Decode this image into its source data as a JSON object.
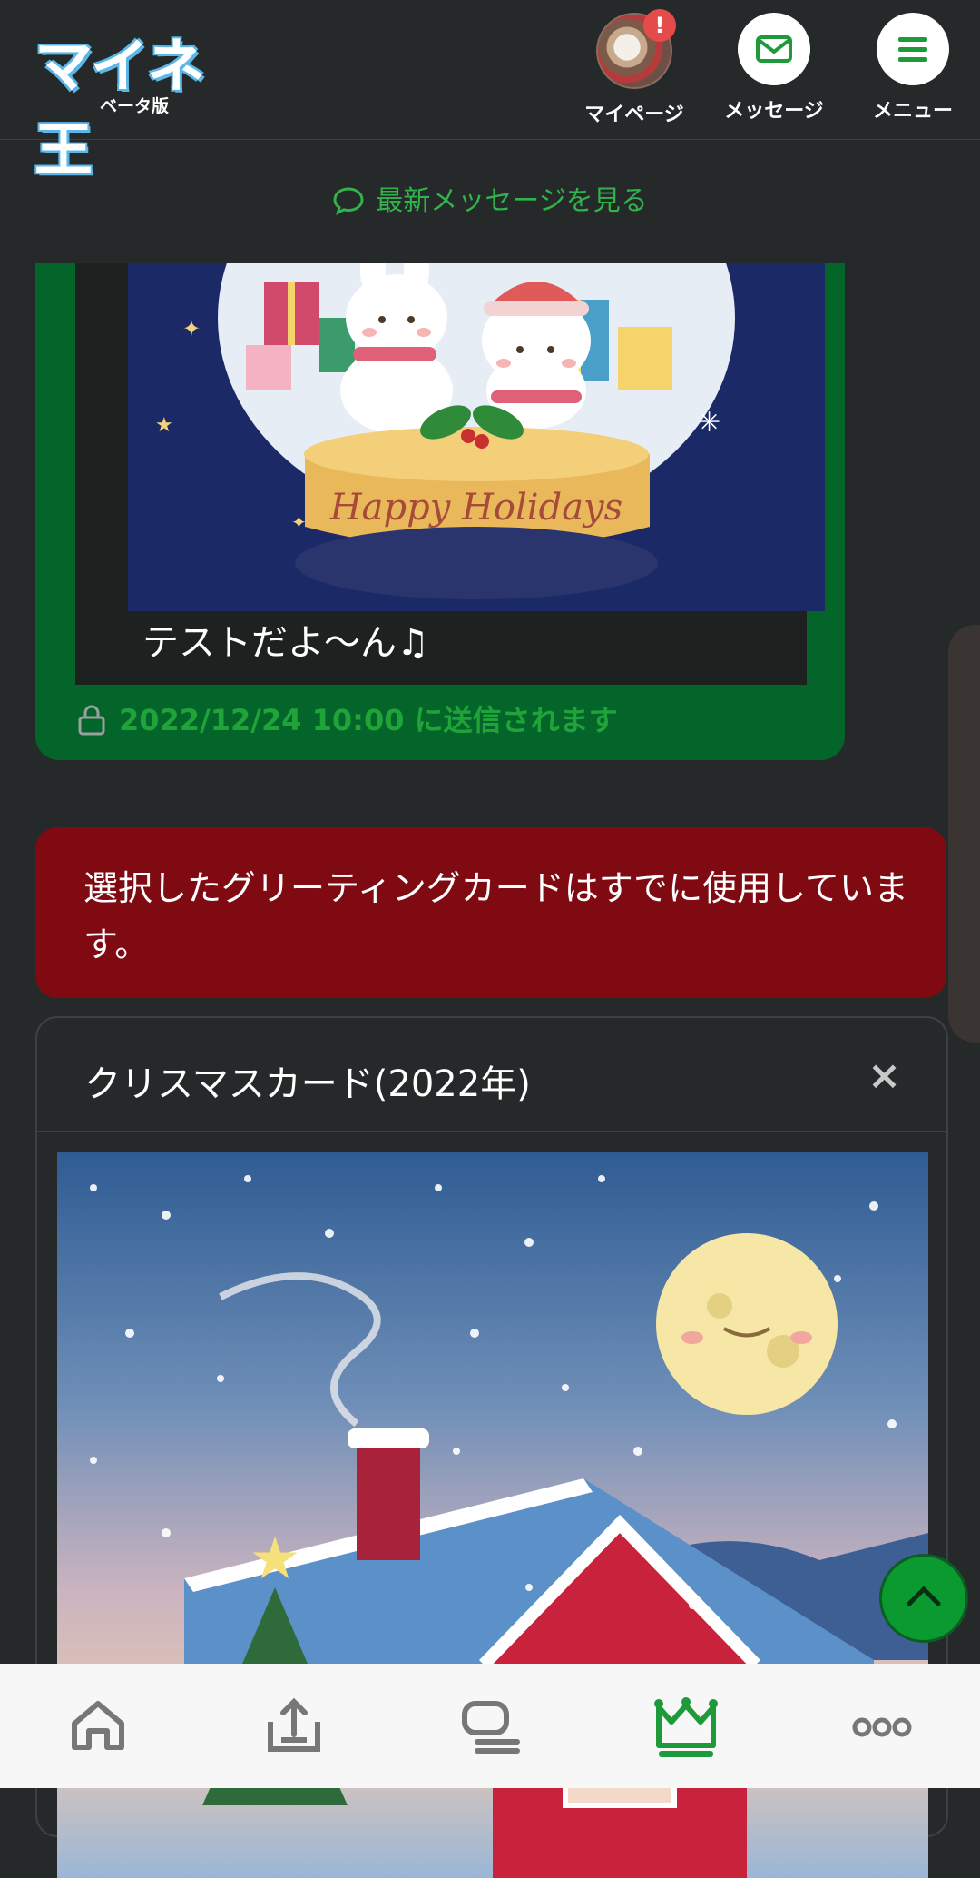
{
  "header": {
    "logo_text": "マイネ王",
    "logo_sub": "ベータ版",
    "nav": [
      {
        "label": "マイページ",
        "icon": "avatar",
        "badge": "!"
      },
      {
        "label": "メッセージ",
        "icon": "envelope-icon"
      },
      {
        "label": "メニュー",
        "icon": "hamburger-icon"
      }
    ]
  },
  "latest_messages_link": "最新メッセージを見る",
  "scheduled_card": {
    "image_caption": "Happy Holidays",
    "message": "テストだよ〜ん♫",
    "schedule_text": "2022/12/24 10:00 に送信されます"
  },
  "alert": {
    "text": "選択したグリーティングカードはすでに使用しています。"
  },
  "card_panel": {
    "title": "クリスマスカード(2022年)",
    "close_label": "×"
  },
  "tabbar": {
    "tabs": [
      "home-icon",
      "upload-icon",
      "chat-icon",
      "crown-icon",
      "more-icon"
    ],
    "active_index": 3
  },
  "colors": {
    "accent_green": "#2fb34a",
    "scheduled_green": "#04652a",
    "alert_red": "#7f0a12",
    "background": "#25292a"
  }
}
